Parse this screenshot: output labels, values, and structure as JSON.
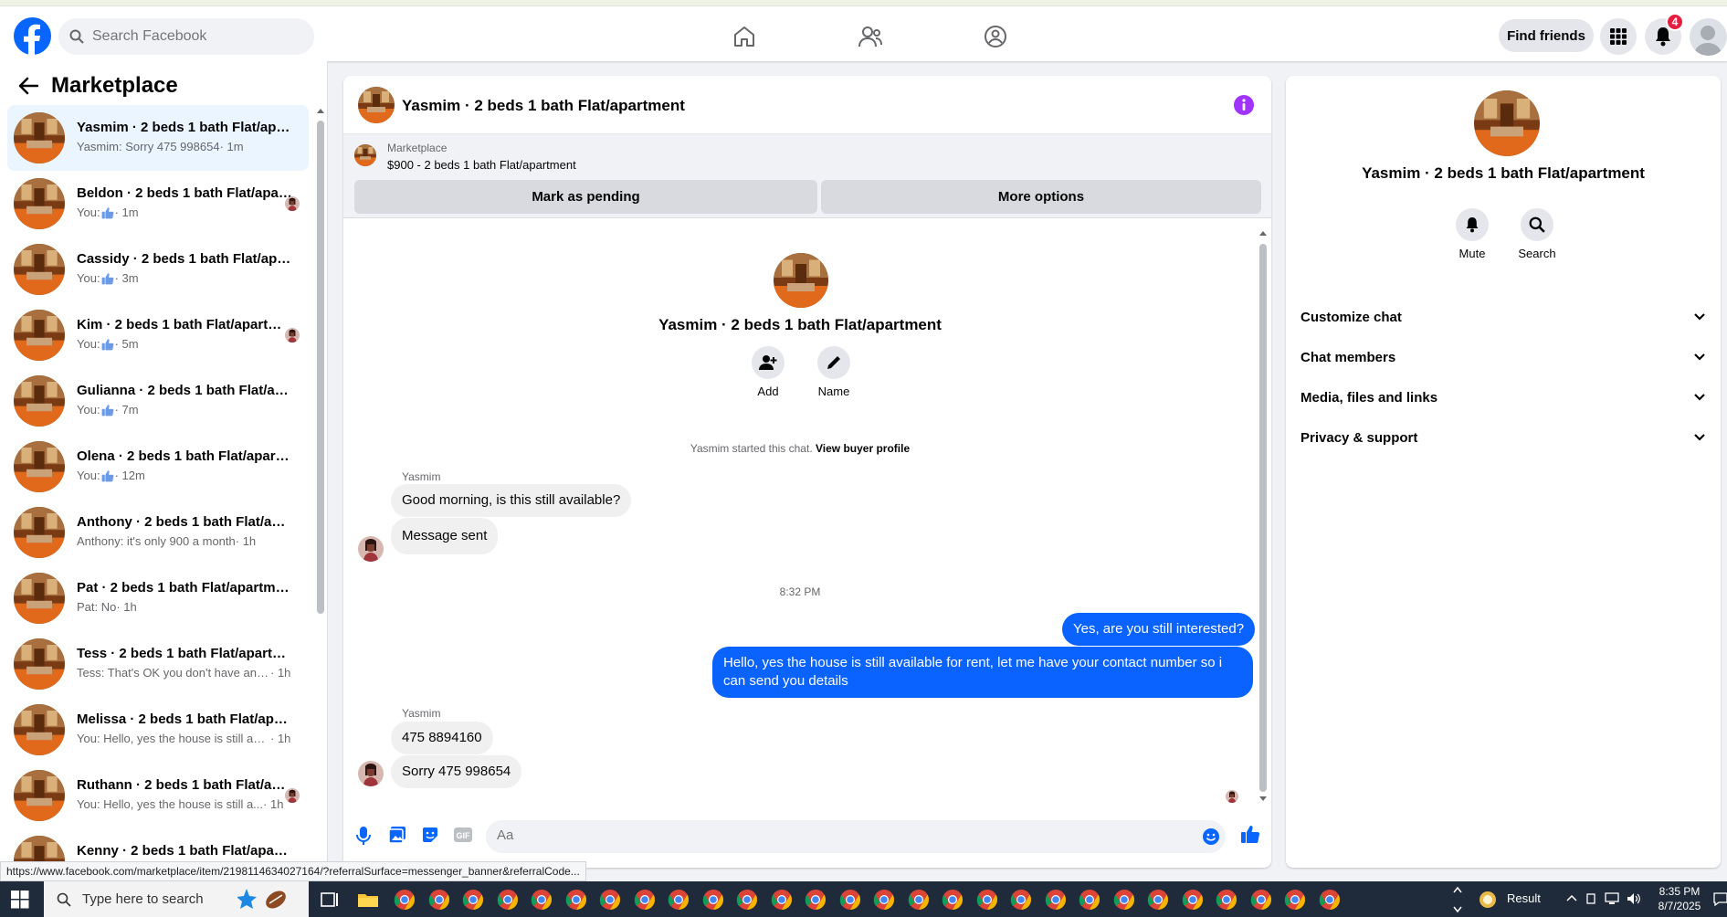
{
  "colors": {
    "brand": "#0866ff",
    "outgoing_bubble": "#0a62ff",
    "badge": "#e41e3f",
    "info_purple": "#a033ff"
  },
  "header": {
    "search_placeholder": "Search Facebook",
    "find_friends_label": "Find friends",
    "notification_count": "4",
    "icons": [
      "facebook-logo",
      "home-icon",
      "friends-icon",
      "groups-icon",
      "menu-grid-icon",
      "bell-icon",
      "profile-avatar"
    ]
  },
  "left_panel": {
    "title": "Marketplace",
    "conversations": [
      {
        "name": "Yasmim · 2 beds 1 bath Flat/apartment",
        "preview": "Yasmim: Sorry 475 998654",
        "time": "· 1m",
        "thumb": false,
        "seen": false,
        "active": true
      },
      {
        "name": "Beldon · 2 beds 1 bath Flat/apartment",
        "preview": "You:",
        "time": "· 1m",
        "thumb": true,
        "seen": true,
        "active": false
      },
      {
        "name": "Cassidy · 2 beds 1 bath Flat/apartment",
        "preview": "You:",
        "time": "· 3m",
        "thumb": true,
        "seen": false,
        "active": false
      },
      {
        "name": "Kim · 2 beds 1 bath Flat/apartment",
        "preview": "You:",
        "time": "· 5m",
        "thumb": true,
        "seen": true,
        "active": false
      },
      {
        "name": "Gulianna · 2 beds 1 bath Flat/apartment",
        "preview": "You:",
        "time": "· 7m",
        "thumb": true,
        "seen": false,
        "active": false
      },
      {
        "name": "Olena · 2 beds 1 bath Flat/apartment",
        "preview": "You:",
        "time": "· 12m",
        "thumb": true,
        "seen": false,
        "active": false
      },
      {
        "name": "Anthony · 2 beds 1 bath Flat/apartment",
        "preview": "Anthony: it's only 900 a month",
        "time": "· 1h",
        "thumb": false,
        "seen": false,
        "active": false
      },
      {
        "name": "Pat · 2 beds 1 bath Flat/apartment",
        "preview": "Pat: No",
        "time": "· 1h",
        "thumb": false,
        "seen": false,
        "active": false
      },
      {
        "name": "Tess · 2 beds 1 bath Flat/apartment",
        "preview": "Tess: That's OK you don't have any ...",
        "time": "· 1h",
        "thumb": false,
        "seen": false,
        "active": false
      },
      {
        "name": "Melissa · 2 beds 1 bath Flat/apartment",
        "preview": "You: Hello, yes the house is still avai...",
        "time": "· 1h",
        "thumb": false,
        "seen": false,
        "active": false
      },
      {
        "name": "Ruthann · 2 beds 1 bath Flat/apartment",
        "preview": "You: Hello, yes the house is still a...",
        "time": "· 1h",
        "thumb": false,
        "seen": true,
        "active": false
      },
      {
        "name": "Kenny · 2 beds 1 bath Flat/apartment",
        "preview": "",
        "time": "",
        "thumb": false,
        "seen": false,
        "active": false
      }
    ]
  },
  "chat": {
    "title": "Yasmim · 2 beds 1 bath Flat/apartment",
    "marketplace": {
      "label": "Marketplace",
      "listing": "$900 - 2 beds 1 bath Flat/apartment",
      "mark_pending_label": "Mark as pending",
      "more_options_label": "More options"
    },
    "intro": {
      "name": "Yasmim · 2 beds 1 bath Flat/apartment",
      "add_label": "Add",
      "name_label": "Name",
      "started_text": "Yasmim started this chat.",
      "view_profile_label": "View buyer profile"
    },
    "messages": {
      "sender_1": "Yasmim",
      "in_1": "Good morning, is this still available?",
      "in_2": "Message sent",
      "time_sep": "8:32 PM",
      "out_1": "Yes, are you still interested?",
      "out_2": "Hello, yes the house is still available for rent, let me have your contact number so i can send you details",
      "sender_2": "Yasmim",
      "in_3": "475 8894160",
      "in_4": "Sorry 475 998654"
    },
    "composer_placeholder": "Aa"
  },
  "right_panel": {
    "name": "Yasmim · 2 beds 1 bath Flat/apartment",
    "mute_label": "Mute",
    "search_label": "Search",
    "sections": [
      "Customize chat",
      "Chat members",
      "Media, files and links",
      "Privacy & support"
    ]
  },
  "status_url": "https://www.facebook.com/marketplace/item/2198114634027164/?referralSurface=messenger_banner&referralCode...",
  "taskbar": {
    "search_placeholder": "Type here to search",
    "weather_label": "Result",
    "time": "8:35 PM",
    "date": "8/7/2025"
  }
}
